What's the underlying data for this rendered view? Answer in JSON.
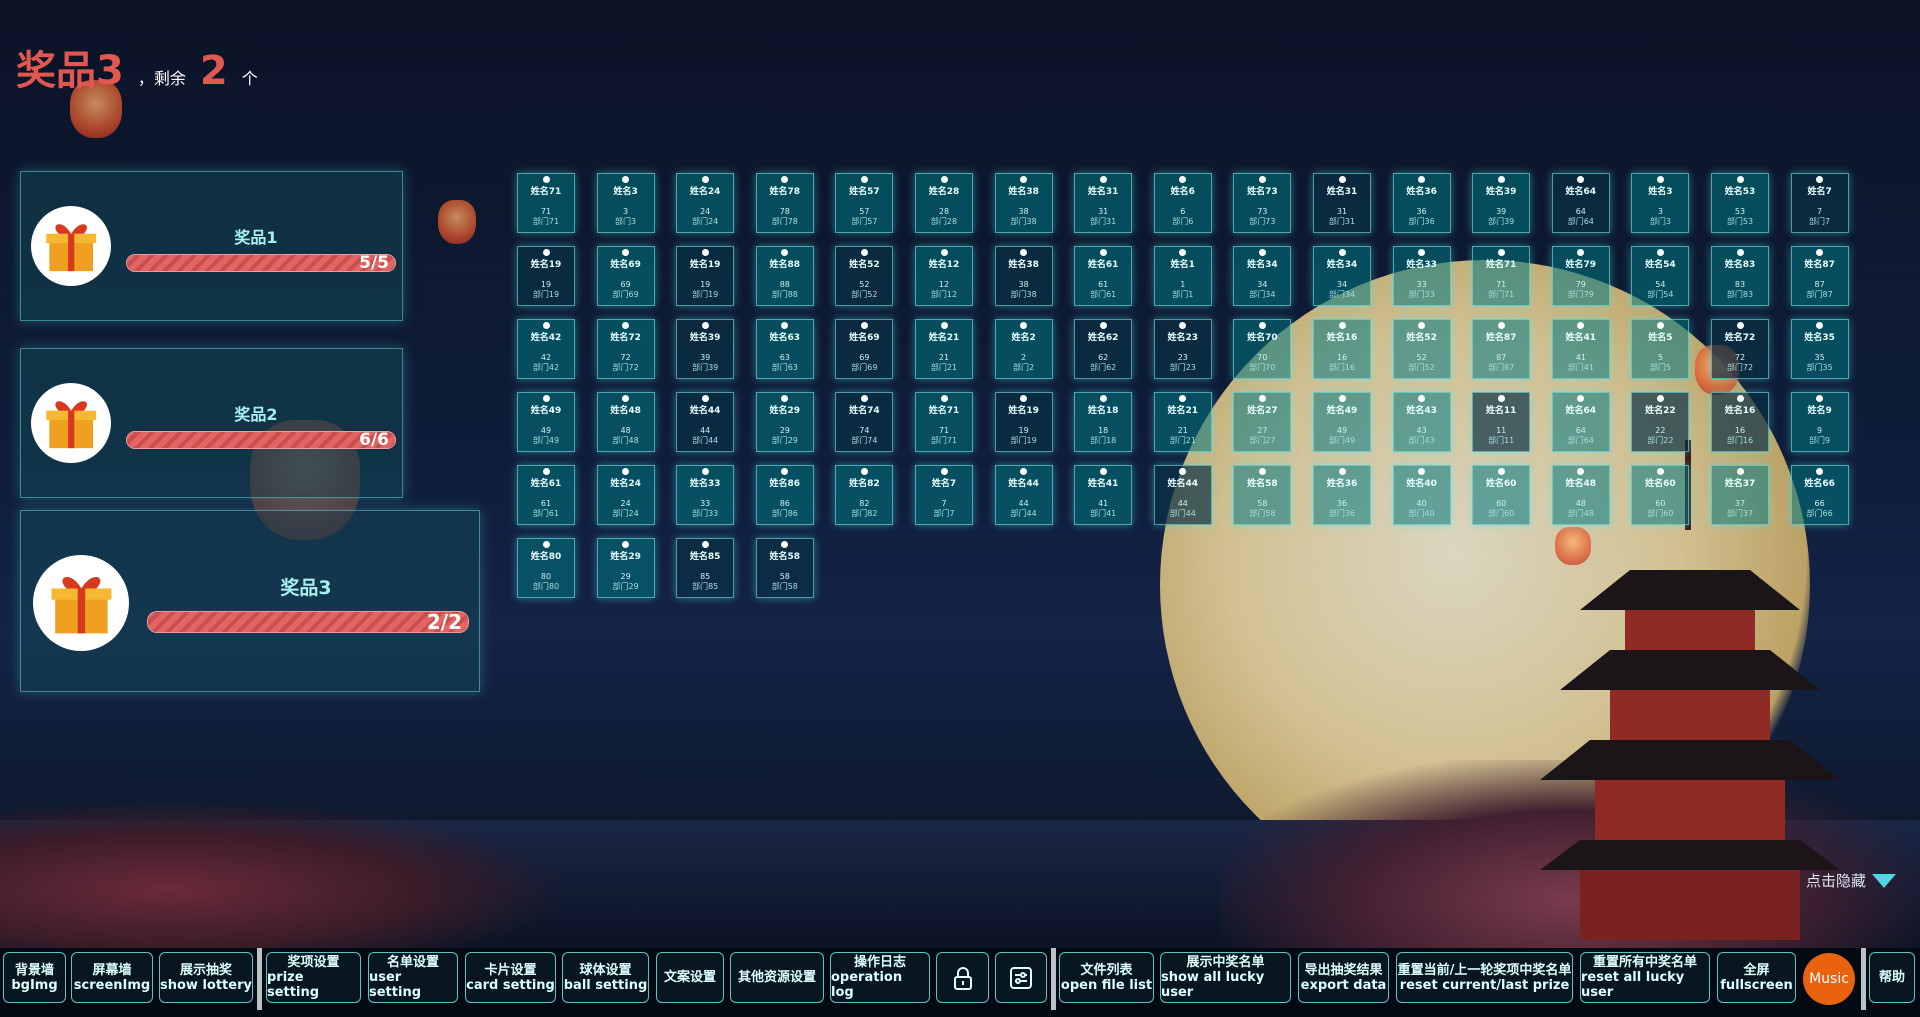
{
  "header": {
    "prize": "奖品3",
    "remaining_label": "，剩余",
    "remaining_count": "2",
    "unit": "个"
  },
  "prizes": [
    {
      "name": "奖品1",
      "progress_text": "5/5",
      "progress": 1.0
    },
    {
      "name": "奖品2",
      "progress_text": "6/6",
      "progress": 1.0
    },
    {
      "name": "奖品3",
      "progress_text": "2/2",
      "progress": 1.0
    }
  ],
  "cards": [
    {
      "name": "姓名71",
      "num": "71",
      "dept": "部门71"
    },
    {
      "name": "姓名3",
      "num": "3",
      "dept": "部门3"
    },
    {
      "name": "姓名24",
      "num": "24",
      "dept": "部门24"
    },
    {
      "name": "姓名78",
      "num": "78",
      "dept": "部门78"
    },
    {
      "name": "姓名57",
      "num": "57",
      "dept": "部门57"
    },
    {
      "name": "姓名28",
      "num": "28",
      "dept": "部门28"
    },
    {
      "name": "姓名38",
      "num": "38",
      "dept": "部门38"
    },
    {
      "name": "姓名31",
      "num": "31",
      "dept": "部门31"
    },
    {
      "name": "姓名6",
      "num": "6",
      "dept": "部门6"
    },
    {
      "name": "姓名73",
      "num": "73",
      "dept": "部门73"
    },
    {
      "name": "姓名31",
      "num": "31",
      "dept": "部门31"
    },
    {
      "name": "姓名36",
      "num": "36",
      "dept": "部门36"
    },
    {
      "name": "姓名39",
      "num": "39",
      "dept": "部门39"
    },
    {
      "name": "姓名64",
      "num": "64",
      "dept": "部门64"
    },
    {
      "name": "姓名3",
      "num": "3",
      "dept": "部门3"
    },
    {
      "name": "姓名53",
      "num": "53",
      "dept": "部门53"
    },
    {
      "name": "姓名7",
      "num": "7",
      "dept": "部门7"
    },
    {
      "name": "姓名19",
      "num": "19",
      "dept": "部门19"
    },
    {
      "name": "姓名69",
      "num": "69",
      "dept": "部门69"
    },
    {
      "name": "姓名19",
      "num": "19",
      "dept": "部门19"
    },
    {
      "name": "姓名88",
      "num": "88",
      "dept": "部门88"
    },
    {
      "name": "姓名52",
      "num": "52",
      "dept": "部门52"
    },
    {
      "name": "姓名12",
      "num": "12",
      "dept": "部门12"
    },
    {
      "name": "姓名38",
      "num": "38",
      "dept": "部门38"
    },
    {
      "name": "姓名61",
      "num": "61",
      "dept": "部门61"
    },
    {
      "name": "姓名1",
      "num": "1",
      "dept": "部门1"
    },
    {
      "name": "姓名34",
      "num": "34",
      "dept": "部门34"
    },
    {
      "name": "姓名34",
      "num": "34",
      "dept": "部门34"
    },
    {
      "name": "姓名33",
      "num": "33",
      "dept": "部门33"
    },
    {
      "name": "姓名71",
      "num": "71",
      "dept": "部门71"
    },
    {
      "name": "姓名79",
      "num": "79",
      "dept": "部门79"
    },
    {
      "name": "姓名54",
      "num": "54",
      "dept": "部门54"
    },
    {
      "name": "姓名83",
      "num": "83",
      "dept": "部门83"
    },
    {
      "name": "姓名87",
      "num": "87",
      "dept": "部门87"
    },
    {
      "name": "姓名42",
      "num": "42",
      "dept": "部门42"
    },
    {
      "name": "姓名72",
      "num": "72",
      "dept": "部门72"
    },
    {
      "name": "姓名39",
      "num": "39",
      "dept": "部门39"
    },
    {
      "name": "姓名63",
      "num": "63",
      "dept": "部门63"
    },
    {
      "name": "姓名69",
      "num": "69",
      "dept": "部门69"
    },
    {
      "name": "姓名21",
      "num": "21",
      "dept": "部门21"
    },
    {
      "name": "姓名2",
      "num": "2",
      "dept": "部门2"
    },
    {
      "name": "姓名62",
      "num": "62",
      "dept": "部门62"
    },
    {
      "name": "姓名23",
      "num": "23",
      "dept": "部门23"
    },
    {
      "name": "姓名70",
      "num": "70",
      "dept": "部门70"
    },
    {
      "name": "姓名16",
      "num": "16",
      "dept": "部门16"
    },
    {
      "name": "姓名52",
      "num": "52",
      "dept": "部门52"
    },
    {
      "name": "姓名87",
      "num": "87",
      "dept": "部门87"
    },
    {
      "name": "姓名41",
      "num": "41",
      "dept": "部门41"
    },
    {
      "name": "姓名5",
      "num": "5",
      "dept": "部门5"
    },
    {
      "name": "姓名72",
      "num": "72",
      "dept": "部门72"
    },
    {
      "name": "姓名35",
      "num": "35",
      "dept": "部门35"
    },
    {
      "name": "姓名49",
      "num": "49",
      "dept": "部门49"
    },
    {
      "name": "姓名48",
      "num": "48",
      "dept": "部门48"
    },
    {
      "name": "姓名44",
      "num": "44",
      "dept": "部门44"
    },
    {
      "name": "姓名29",
      "num": "29",
      "dept": "部门29"
    },
    {
      "name": "姓名74",
      "num": "74",
      "dept": "部门74"
    },
    {
      "name": "姓名71",
      "num": "71",
      "dept": "部门71"
    },
    {
      "name": "姓名19",
      "num": "19",
      "dept": "部门19"
    },
    {
      "name": "姓名18",
      "num": "18",
      "dept": "部门18"
    },
    {
      "name": "姓名21",
      "num": "21",
      "dept": "部门21"
    },
    {
      "name": "姓名27",
      "num": "27",
      "dept": "部门27"
    },
    {
      "name": "姓名49",
      "num": "49",
      "dept": "部门49"
    },
    {
      "name": "姓名43",
      "num": "43",
      "dept": "部门43"
    },
    {
      "name": "姓名11",
      "num": "11",
      "dept": "部门11"
    },
    {
      "name": "姓名64",
      "num": "64",
      "dept": "部门64"
    },
    {
      "name": "姓名22",
      "num": "22",
      "dept": "部门22"
    },
    {
      "name": "姓名16",
      "num": "16",
      "dept": "部门16"
    },
    {
      "name": "姓名9",
      "num": "9",
      "dept": "部门9"
    },
    {
      "name": "姓名61",
      "num": "61",
      "dept": "部门61"
    },
    {
      "name": "姓名24",
      "num": "24",
      "dept": "部门24"
    },
    {
      "name": "姓名33",
      "num": "33",
      "dept": "部门33"
    },
    {
      "name": "姓名86",
      "num": "86",
      "dept": "部门86"
    },
    {
      "name": "姓名82",
      "num": "82",
      "dept": "部门82"
    },
    {
      "name": "姓名7",
      "num": "7",
      "dept": "部门7"
    },
    {
      "name": "姓名44",
      "num": "44",
      "dept": "部门44"
    },
    {
      "name": "姓名41",
      "num": "41",
      "dept": "部门41"
    },
    {
      "name": "姓名44",
      "num": "44",
      "dept": "部门44"
    },
    {
      "name": "姓名58",
      "num": "58",
      "dept": "部门58"
    },
    {
      "name": "姓名36",
      "num": "36",
      "dept": "部门36"
    },
    {
      "name": "姓名40",
      "num": "40",
      "dept": "部门40"
    },
    {
      "name": "姓名60",
      "num": "60",
      "dept": "部门60"
    },
    {
      "name": "姓名48",
      "num": "48",
      "dept": "部门48"
    },
    {
      "name": "姓名60",
      "num": "60",
      "dept": "部门60"
    },
    {
      "name": "姓名37",
      "num": "37",
      "dept": "部门37"
    },
    {
      "name": "姓名66",
      "num": "66",
      "dept": "部门66"
    },
    {
      "name": "姓名80",
      "num": "80",
      "dept": "部门80"
    },
    {
      "name": "姓名29",
      "num": "29",
      "dept": "部门29"
    },
    {
      "name": "姓名85",
      "num": "85",
      "dept": "部门85"
    },
    {
      "name": "姓名58",
      "num": "58",
      "dept": "部门58"
    }
  ],
  "toolbar": {
    "bgimg": {
      "zh": "背景墙",
      "en": "bgImg"
    },
    "screenimg": {
      "zh": "屏幕墙",
      "en": "screenImg"
    },
    "show_lottery": {
      "zh": "展示抽奖",
      "en": "show lottery"
    },
    "prize_setting": {
      "zh": "奖项设置",
      "en": "prize setting"
    },
    "user_setting": {
      "zh": "名单设置",
      "en": "user setting"
    },
    "card_setting": {
      "zh": "卡片设置",
      "en": "card setting"
    },
    "ball_setting": {
      "zh": "球体设置",
      "en": "ball setting"
    },
    "text_setting": {
      "zh": "文案设置"
    },
    "other_resource": {
      "zh": "其他资源设置"
    },
    "operation_log": {
      "zh": "操作日志",
      "en": "operation log"
    },
    "open_file_list": {
      "zh": "文件列表",
      "en": "open file list"
    },
    "show_lucky": {
      "zh": "展示中奖名单",
      "en": "show all lucky user"
    },
    "export": {
      "zh": "导出抽奖结果",
      "en": "export data"
    },
    "reset_current": {
      "zh": "重置当前/上一轮奖项中奖名单",
      "en": "reset current/last prize"
    },
    "reset_all": {
      "zh": "重置所有中奖名单",
      "en": "reset all lucky user"
    },
    "fullscreen": {
      "zh": "全屏",
      "en": "fullscreen"
    },
    "music": "Music",
    "help": "帮助"
  },
  "hide_label": "点击隐藏",
  "icons": {
    "lock": "lock-icon",
    "settings": "sliders-icon",
    "gift": "gift-icon",
    "hide_arrow": "triangle-down-icon"
  },
  "colors": {
    "accent": "#e0584f",
    "card": "#0a8590",
    "border": "#5fc3c3",
    "music": "#e8620f"
  }
}
